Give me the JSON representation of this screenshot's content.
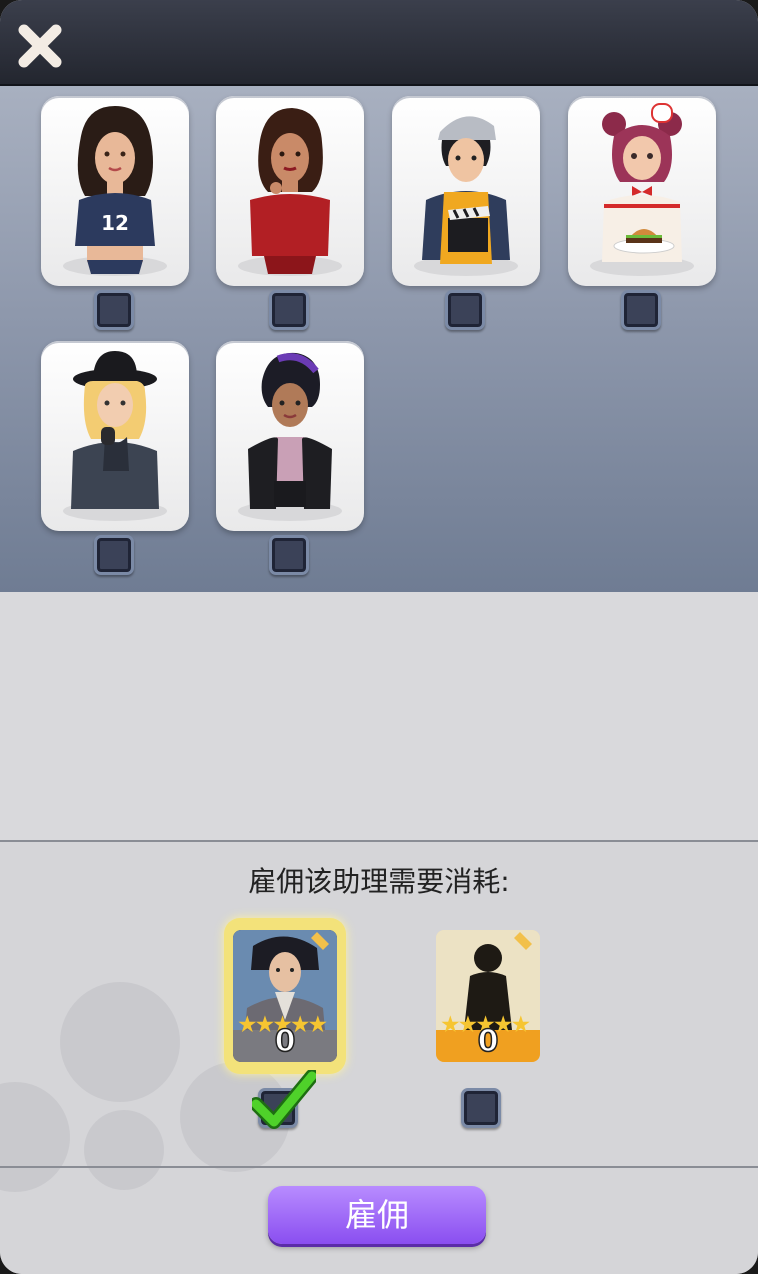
{
  "header": {
    "close_icon": "close-icon"
  },
  "characters": [
    {
      "id": "char-1",
      "icon": "portrait-woman-football-jersey",
      "jersey_number": "12",
      "checked": false
    },
    {
      "id": "char-2",
      "icon": "portrait-woman-red-top",
      "checked": false
    },
    {
      "id": "char-3",
      "icon": "portrait-man-clapperboard",
      "checked": false
    },
    {
      "id": "char-4",
      "icon": "portrait-chef-girl-burger",
      "checked": false
    },
    {
      "id": "char-5",
      "icon": "portrait-woman-black-hat",
      "checked": false
    },
    {
      "id": "char-6",
      "icon": "portrait-woman-leather-jacket",
      "checked": false
    }
  ],
  "cost": {
    "prompt": "雇佣该助理需要消耗:",
    "items": [
      {
        "icon": "portrait-man-robe-card",
        "stars": 5,
        "count": "0",
        "checked": true
      },
      {
        "icon": "silhouette-card",
        "stars": 5,
        "count": "0",
        "checked": false
      }
    ]
  },
  "hire_button": {
    "label": "雇佣"
  },
  "colors": {
    "header": "#2c2f3a",
    "hire_button": "#9b63f5",
    "checkbox": "#3b4258",
    "checkmark": "#3fbf2a",
    "star": "#f6c531"
  }
}
